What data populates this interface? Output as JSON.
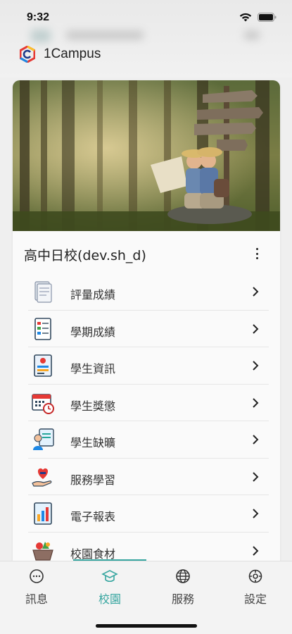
{
  "status_bar": {
    "time": "9:32"
  },
  "app": {
    "title": "1Campus",
    "brand_colors": [
      "#e53935",
      "#fbc02d",
      "#1e88e5"
    ]
  },
  "school": {
    "name": "高中日校(dev.sh_d)"
  },
  "menu": {
    "items": [
      {
        "label": "評量成績",
        "icon": "exam-paper-icon"
      },
      {
        "label": "學期成績",
        "icon": "report-card-icon"
      },
      {
        "label": "學生資訊",
        "icon": "student-id-card-icon"
      },
      {
        "label": "學生獎懲",
        "icon": "calendar-clock-icon"
      },
      {
        "label": "學生缺曠",
        "icon": "student-attendance-icon"
      },
      {
        "label": "服務學習",
        "icon": "heart-hand-icon"
      },
      {
        "label": "電子報表",
        "icon": "book-chart-icon"
      },
      {
        "label": "校園食材",
        "icon": "food-basket-icon"
      }
    ]
  },
  "tabs": [
    {
      "label": "訊息",
      "icon": "message-bubble-icon",
      "active": false
    },
    {
      "label": "校園",
      "icon": "graduation-cap-icon",
      "active": true
    },
    {
      "label": "服務",
      "icon": "globe-icon",
      "active": false
    },
    {
      "label": "設定",
      "icon": "gear-icon",
      "active": false
    }
  ],
  "colors": {
    "accent": "#37a6a0"
  }
}
